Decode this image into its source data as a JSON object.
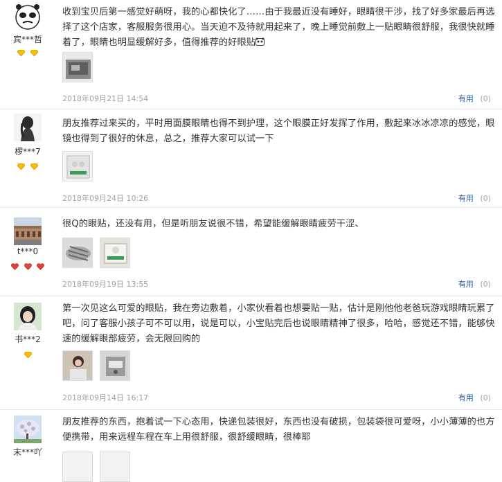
{
  "reviews": [
    {
      "user": "宾***哲",
      "avatar_icon": "panda-meme-avatar",
      "badge_icon": "gold-diamond",
      "badge_count": 2,
      "text": "收到宝贝后第一感觉好萌呀，我的心都快化了……由于我最近没有睡好，眼睛很干涉，找了好多家最后再选择了这个店家，客服服务很用心。当天迫不及待就用起来了，晚上睡觉前敷上一贴眼睛很舒服，我很快就睡着了，眼睛也明显缓解好多，值得推荐的好眼贴",
      "date": "2018年09月21日 14:54",
      "useful_label": "有用",
      "useful_count": "(0)"
    },
    {
      "user": "椤***7",
      "avatar_icon": "girl-silhouette-avatar",
      "badge_icon": "gold-diamond",
      "badge_count": 2,
      "text": "朋友推荐过来买的，平时用面膜眼睛也得不到护理，这个眼膜正好发挥了作用，敷起来冰冰凉凉的感觉，眼镜也得到了很好的休息，总之，推荐大家可以试一下",
      "date": "2018年09月24日 10:26",
      "useful_label": "有用",
      "useful_count": "(0)"
    },
    {
      "user": "t***0",
      "avatar_icon": "building-photo-avatar",
      "badge_icon": "red-heart",
      "badge_count": 3,
      "text": "很Q的眼贴，还没有用，但是听朋友说很不错，希望能缓解眼睛疲劳干涩、",
      "date": "2018年09月19日 13:55",
      "useful_label": "有用",
      "useful_count": "(0)"
    },
    {
      "user": "书***2",
      "avatar_icon": "girl-photo-avatar",
      "badge_icon": "gold-diamond",
      "badge_count": 1,
      "text": "第一次见这么可爱的眼贴，我在旁边敷着，小家伙看着也想要贴一贴，估计是刚他他老爸玩游戏眼睛玩累了吧，问了客服小孩子可不可以用，说是可以，小宝贴完后也说眼睛精神了很多，哈哈，感觉还不错，能够快速的缓解眼部疲劳，会无限回购的",
      "date": "2018年09月14日 16:17",
      "useful_label": "有用",
      "useful_count": "(0)"
    },
    {
      "user": "末***吖",
      "avatar_icon": "tree-photo-avatar",
      "badge_icon": "gold-diamond",
      "badge_count": 0,
      "text": "朋友推荐的东西，抱着试一下心态用，快递包装很好，东西也没有破损，包装袋很可爱呀，小小薄薄的也方便携带，用来远程车程在车上用很舒服，很舒缓眼睛，很棒耶",
      "date": "",
      "useful_label": "",
      "useful_count": ""
    }
  ]
}
